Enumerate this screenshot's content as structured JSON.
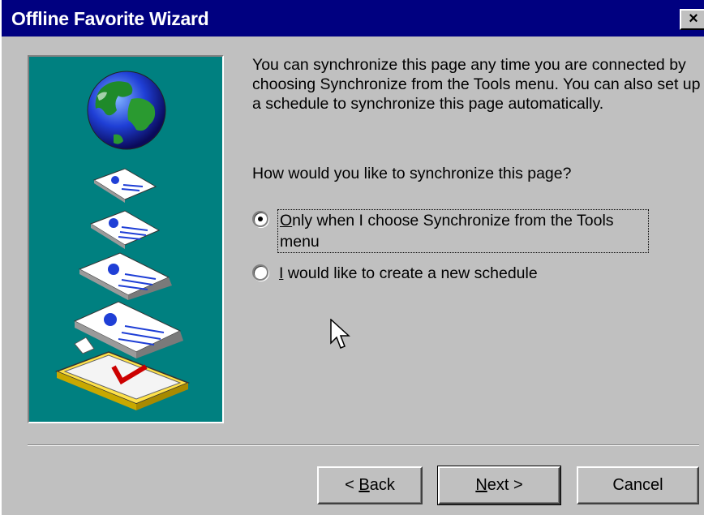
{
  "window": {
    "title": "Offline Favorite Wizard",
    "close_glyph": "×"
  },
  "content": {
    "description": "You can synchronize this page any time you are connected by choosing Synchronize from the Tools menu. You can also set up a schedule to synchronize this page automatically.",
    "question": "How would you like to synchronize this page?",
    "options": [
      {
        "mnemonic": "O",
        "rest": "nly when I choose Synchronize from the Tools menu",
        "checked": true
      },
      {
        "mnemonic": "I",
        "rest": " would like to create a new schedule",
        "checked": false
      }
    ]
  },
  "buttons": {
    "back_prefix": "< ",
    "back_mnemonic": "B",
    "back_rest": "ack",
    "next_mnemonic": "N",
    "next_rest": "ext >",
    "cancel": "Cancel"
  },
  "colors": {
    "title_bar": "#000080",
    "art_background": "#008080",
    "dialog_face": "#c0c0c0"
  },
  "icons": [
    "globe-icon",
    "offline-pages-illustration",
    "mouse-pointer-icon",
    "close-icon"
  ]
}
